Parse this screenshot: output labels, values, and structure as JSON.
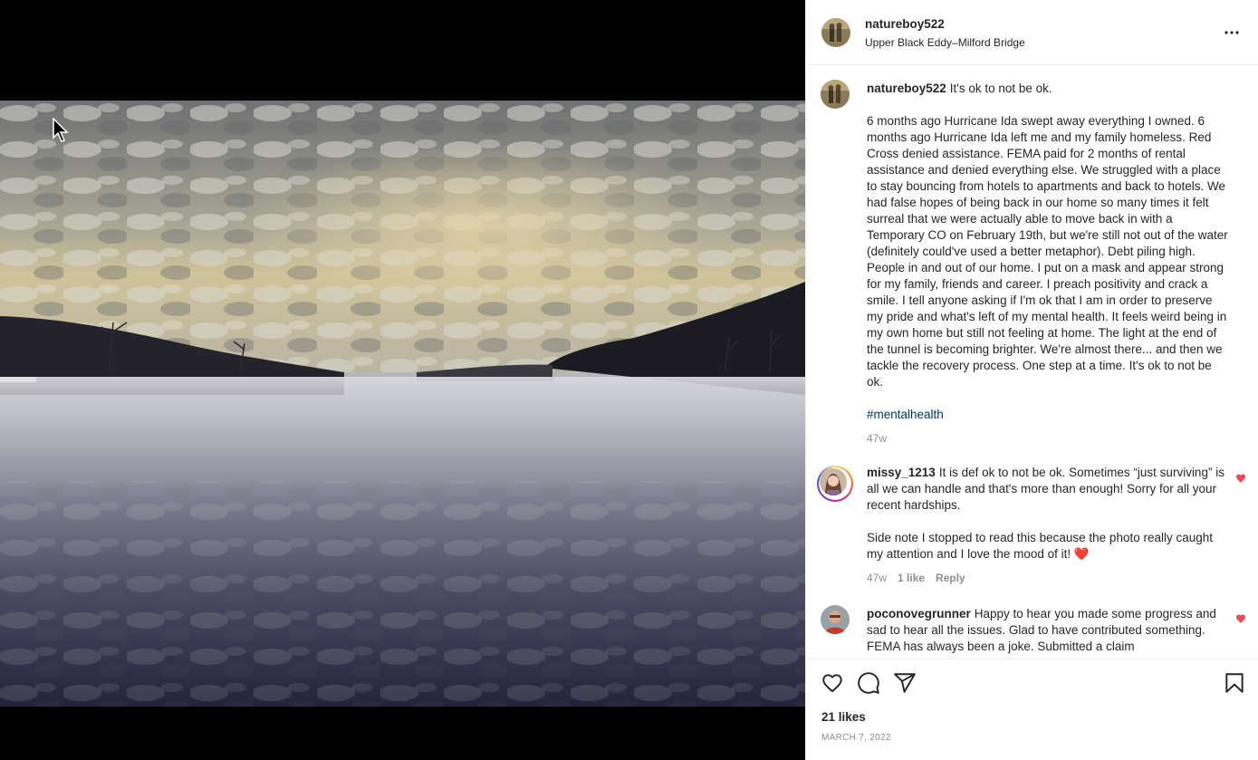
{
  "post": {
    "username": "natureboy522",
    "location": "Upper Black Eddy–Milford Bridge",
    "likes": "21 likes",
    "date": "MARCH 7, 2022"
  },
  "caption": {
    "username": "natureboy522",
    "lead": "It's ok to not be ok.",
    "body": "6 months ago Hurricane Ida swept away everything I owned. 6 months ago Hurricane Ida left me and my family homeless. Red Cross denied assistance. FEMA paid for 2 months of rental assistance and denied everything else. We struggled with a place to stay bouncing from hotels to apartments and back to hotels. We had false hopes of being back in our home so many times it felt surreal that we were actually able to move back in with a Temporary CO on February 19th, but we're still not out of the water (definitely could've used a better metaphor). Debt piling high. People in and out of our home. I put on a mask and appear strong for my family, friends and career. I preach positivity and crack a smile. I tell anyone asking if I'm ok that I am in order to preserve my pride and what's left of my mental health. It feels weird being in my own home but still not feeling at home. The light at the end of the tunnel is becoming brighter. We're almost there... and then we tackle the recovery process. One step at a time. It's ok to not be ok.",
    "hashtag": "#mentalhealth",
    "time": "47w"
  },
  "comments": [
    {
      "username": "missy_1213",
      "text": "It is def ok to not be ok. Sometimes “just surviving” is all we can handle and that's more than enough! Sorry for all your recent hardships.",
      "text2": "Side note I stopped to read this because the photo really caught my attention and I love the mood of it! ❤️",
      "time": "47w",
      "likes": "1 like",
      "reply": "Reply"
    },
    {
      "username": "poconovegrunner",
      "text": "Happy to hear you made some progress and sad to hear all the issues. Glad to have contributed something. FEMA has always been a joke. Submitted a claim"
    }
  ],
  "icons": {
    "more": "more-options-icon",
    "like": "heart-icon",
    "comment": "comment-icon",
    "share": "share-icon",
    "save": "bookmark-icon"
  },
  "colors": {
    "like_red": "#ed4956",
    "hashtag_blue": "#00376b",
    "muted": "#8e8e8e"
  }
}
